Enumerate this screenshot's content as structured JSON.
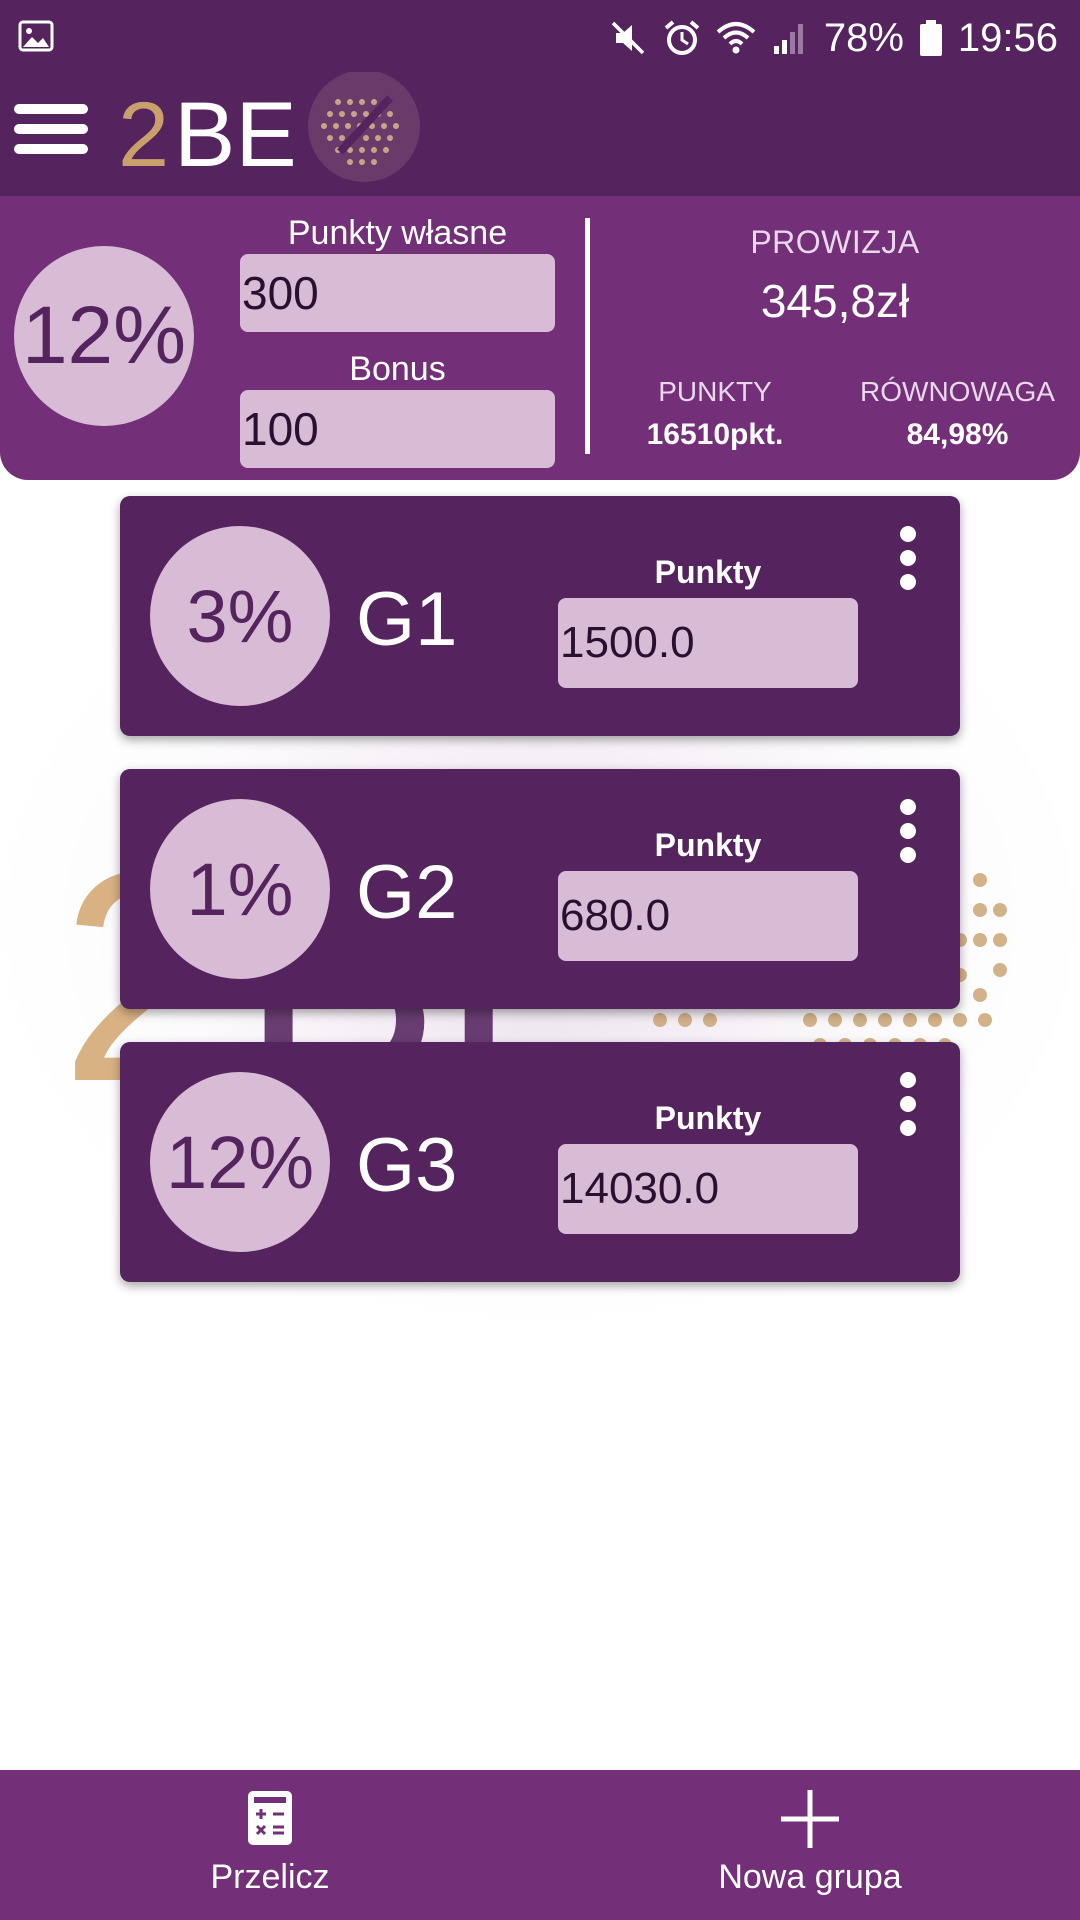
{
  "status_bar": {
    "battery": "78%",
    "time": "19:56",
    "icons": [
      "gallery-icon",
      "mute-icon",
      "alarm-icon",
      "wifi-icon",
      "signal-icon",
      "battery-icon"
    ]
  },
  "app_bar": {
    "logo_text": "2BE",
    "icons": [
      "menu-icon"
    ]
  },
  "summary": {
    "level_percent": "12%",
    "own_points_label": "Punkty własne",
    "own_points_value": "300",
    "bonus_label": "Bonus",
    "bonus_value": "100",
    "commission_label": "PROWIZJA",
    "commission_value": "345,8zł",
    "points_label": "PUNKTY",
    "points_value": "16510pkt.",
    "balance_label": "RÓWNOWAGA",
    "balance_value": "84,98%"
  },
  "groups": [
    {
      "percent": "3%",
      "name": "G1",
      "points_label": "Punkty",
      "points_value": "1500.0"
    },
    {
      "percent": "1%",
      "name": "G2",
      "points_label": "Punkty",
      "points_value": "680.0"
    },
    {
      "percent": "12%",
      "name": "G3",
      "points_label": "Punkty",
      "points_value": "14030.0"
    }
  ],
  "bottom_bar": {
    "recalculate_label": "Przelicz",
    "new_group_label": "Nowa grupa",
    "icons": [
      "calculator-icon",
      "plus-icon"
    ]
  },
  "colors": {
    "bar_purple": "#55245f",
    "panel_purple": "#732f77",
    "light_lilac": "#d8bcd6",
    "logo_gold": "#c9a06c"
  }
}
